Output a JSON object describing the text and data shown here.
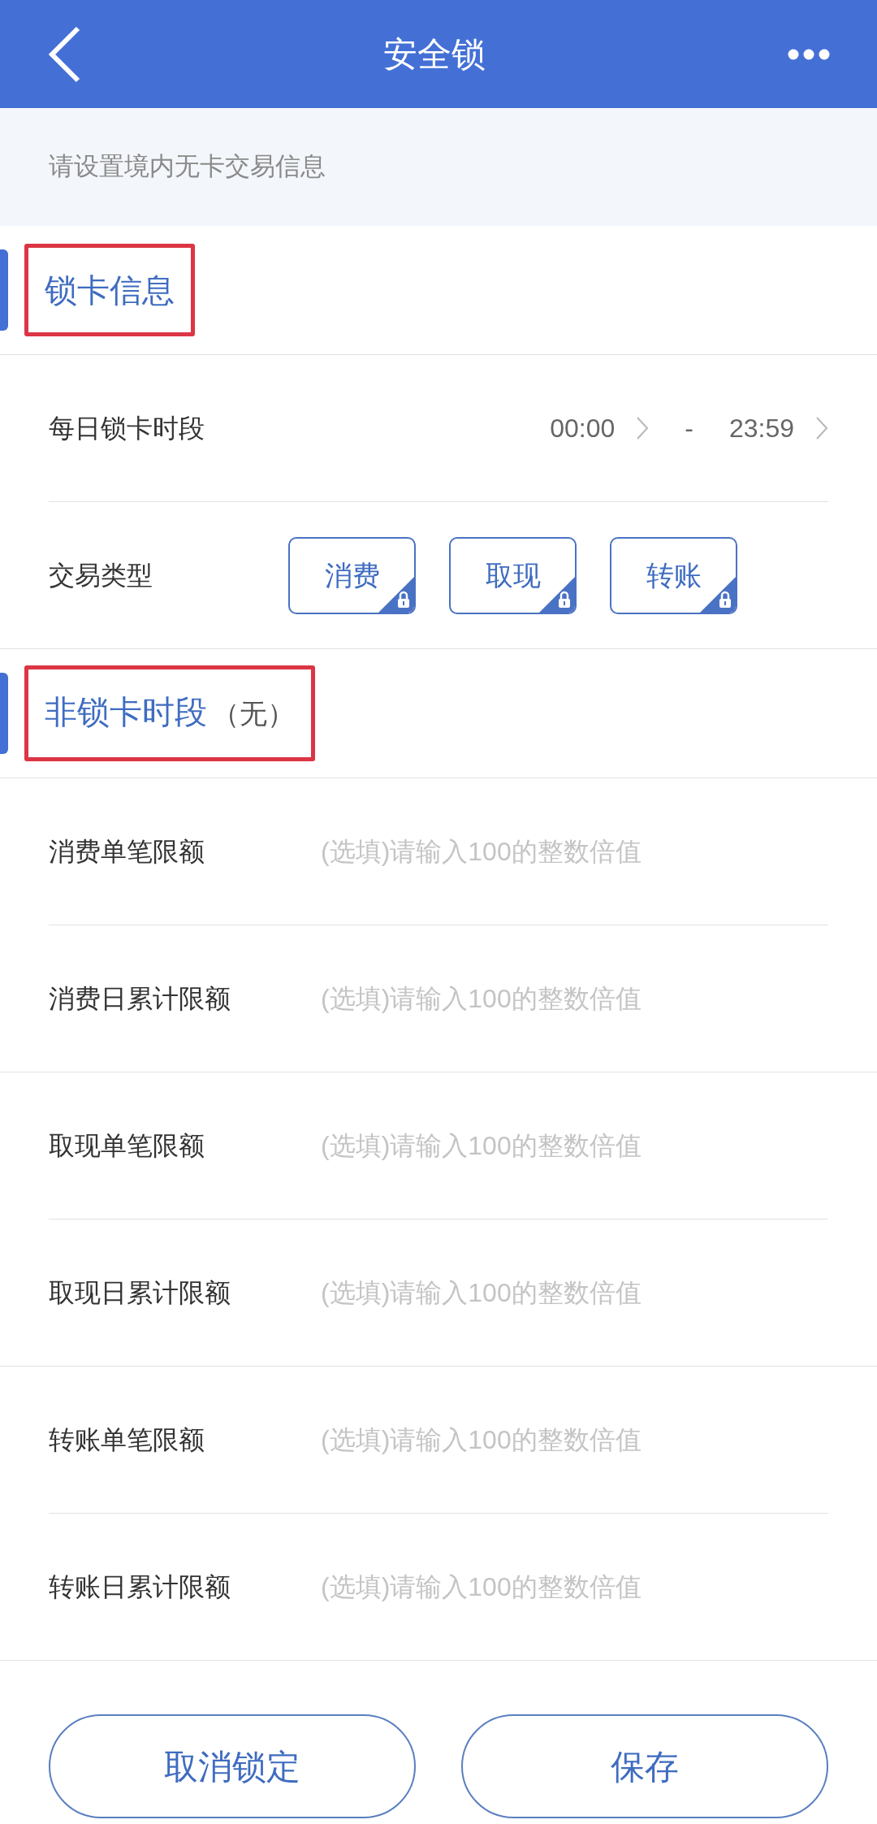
{
  "header": {
    "title": "安全锁"
  },
  "notice": "请设置境内无卡交易信息",
  "sections": [
    {
      "title": "锁卡信息",
      "highlighted": true,
      "groups": [
        {
          "rows": [
            {
              "kind": "time_range",
              "label": "每日锁卡时段",
              "start": "00:00",
              "separator": "-",
              "end": "23:59"
            },
            {
              "kind": "chips",
              "label": "交易类型",
              "chips": [
                {
                  "label": "消费",
                  "locked": true
                },
                {
                  "label": "取现",
                  "locked": true
                },
                {
                  "label": "转账",
                  "locked": true
                }
              ]
            }
          ]
        }
      ]
    },
    {
      "title": "非锁卡时段",
      "note": "（无）",
      "highlighted": true,
      "groups": [
        {
          "rows": [
            {
              "kind": "input",
              "label": "消费单笔限额",
              "placeholder": "(选填)请输入100的整数倍值"
            },
            {
              "kind": "input",
              "label": "消费日累计限额",
              "placeholder": "(选填)请输入100的整数倍值"
            }
          ]
        },
        {
          "rows": [
            {
              "kind": "input",
              "label": "取现单笔限额",
              "placeholder": "(选填)请输入100的整数倍值"
            },
            {
              "kind": "input",
              "label": "取现日累计限额",
              "placeholder": "(选填)请输入100的整数倍值"
            }
          ]
        },
        {
          "rows": [
            {
              "kind": "input",
              "label": "转账单笔限额",
              "placeholder": "(选填)请输入100的整数倍值"
            },
            {
              "kind": "input",
              "label": "转账日累计限额",
              "placeholder": "(选填)请输入100的整数倍值"
            }
          ]
        }
      ]
    }
  ],
  "buttons": [
    {
      "label": "取消锁定"
    },
    {
      "label": "保存"
    }
  ]
}
